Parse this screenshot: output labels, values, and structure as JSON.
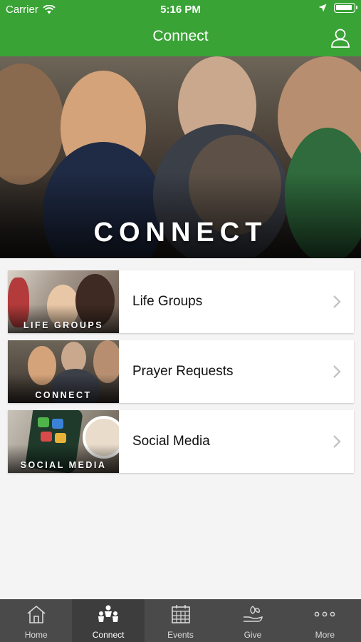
{
  "status": {
    "carrier": "Carrier",
    "time": "5:16 PM"
  },
  "nav": {
    "title": "Connect"
  },
  "hero": {
    "caption": "CONNECT"
  },
  "items": [
    {
      "title": "Life Groups",
      "thumb_label": "LIFE GROUPS"
    },
    {
      "title": "Prayer Requests",
      "thumb_label": "CONNECT"
    },
    {
      "title": "Social Media",
      "thumb_label": "SOCIAL MEDIA"
    }
  ],
  "tabs": [
    {
      "label": "Home",
      "icon": "house-icon"
    },
    {
      "label": "Connect",
      "icon": "people-icon",
      "active": true
    },
    {
      "label": "Events",
      "icon": "calendar-icon"
    },
    {
      "label": "Give",
      "icon": "giving-hand-icon"
    },
    {
      "label": "More",
      "icon": "more-dots-icon"
    }
  ],
  "colors": {
    "brand_green": "#3aa336",
    "tabbar": "#4a4a4a"
  }
}
